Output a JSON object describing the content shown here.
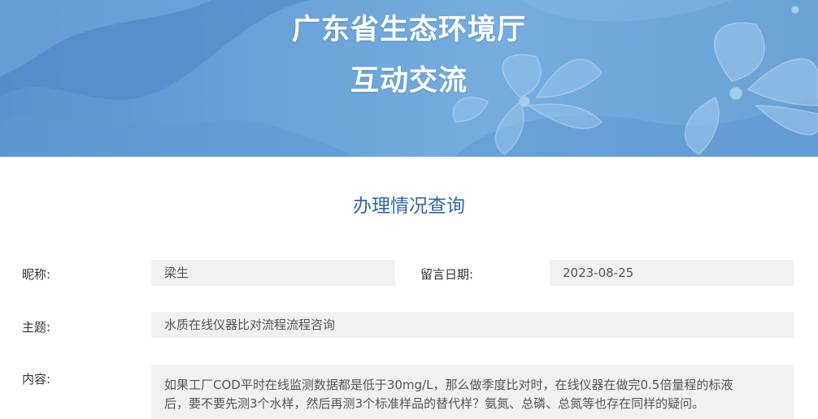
{
  "header": {
    "title_line1": "广东省生态环境厅",
    "title_line2": "互动交流",
    "colors": {
      "banner": "#6aa3d8",
      "text": "#ffffff"
    },
    "decoration": "lily-flower-illustration"
  },
  "section": {
    "title": "办理情况查询",
    "color": "#2f67a8"
  },
  "form": {
    "nickname_label": "昵称:",
    "nickname_value": "梁生",
    "date_label": "留言日期:",
    "date_value": "2023-08-25",
    "subject_label": "主题:",
    "subject_value": "水质在线仪器比对流程流程咨询",
    "content_label": "内容:",
    "content_line1": "如果工厂COD平时在线监测数据都是低于30mg/L，那么做季度比对时，在线仪器在做完0.5倍量程的标液",
    "content_line2": "后，要不要先测3个水样，然后再测3个标准样品的替代样？氨氮、总磷、总氮等也存在同样的疑问。"
  }
}
